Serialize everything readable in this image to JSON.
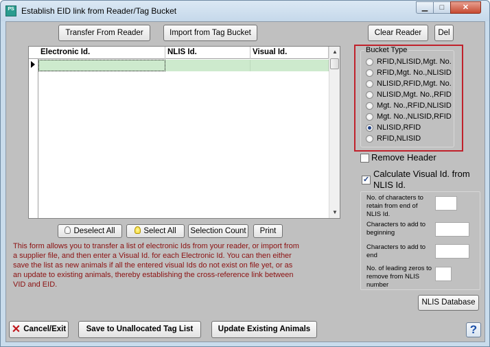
{
  "window": {
    "title": "Establish EID link from Reader/Tag Bucket",
    "app_icon_text": "PS",
    "min_glyph": "▁",
    "max_glyph": "□",
    "close_glyph": "✕"
  },
  "toolbar": {
    "transfer_label": "Transfer From Reader",
    "import_label": "Import from Tag Bucket",
    "clear_label": "Clear Reader",
    "del_label": "Del"
  },
  "grid": {
    "columns": [
      "Electronic Id.",
      "NLIS Id.",
      "Visual Id."
    ],
    "rows": [
      [
        "",
        "",
        ""
      ]
    ],
    "scroll_up": "▲",
    "scroll_down": "▼"
  },
  "bucket_type": {
    "legend": "Bucket Type",
    "options": [
      "RFID,NLISID,Mgt. No.",
      "RFID,Mgt. No.,NLISID",
      "NLISID,RFID,Mgt. No.",
      "NLISID,Mgt. No.,RFID",
      "Mgt. No.,RFID,NLISID",
      "Mgt. No.,NLISID,RFID",
      "NLISID,RFID",
      "RFID,NLISID"
    ],
    "selected_index": 6
  },
  "options": {
    "remove_header_label": "Remove Header",
    "remove_header_checked": false,
    "calc_visual_label_1": "Calculate Visual Id. from",
    "calc_visual_label_2": "NLIS Id.",
    "calc_visual_checked": true
  },
  "calc": {
    "retain_label": "No. of characters to retain from end of NLIS Id.",
    "retain_value": "",
    "add_begin_label": "Characters to add to beginning",
    "add_begin_value": "",
    "add_end_label": "Characters to add to end",
    "add_end_value": "",
    "zeros_label": "No. of leading zeros to remove from NLIS number",
    "zeros_value": ""
  },
  "selection": {
    "deselect_all_label": "Deselect All",
    "select_all_label": "Select All",
    "selection_count_label": "Selection Count",
    "print_label": "Print"
  },
  "info": {
    "text": "This form allows you to transfer a list of electronic Ids from your reader, or import from a supplier file, and then enter a Visual Id. for each Electronic Id. You can then either save the list as new animals if all the entered visual Ids do not exist on file yet, or as an update to existing animals, thereby establishing the cross-reference link between VID and EID."
  },
  "nlis_database_label": "NLIS Database",
  "footer": {
    "cancel_label": "Cancel/Exit",
    "save_label": "Save to Unallocated Tag List",
    "update_label": "Update Existing Animals",
    "help_glyph": "?"
  },
  "colors": {
    "info_text": "#8b1010",
    "grid_row": "#cdeacd",
    "highlight_box": "#c0202a",
    "window_frame": "#c9dcec",
    "form_bg": "#c0c0c0"
  },
  "icons": [
    "app-icon",
    "minimize-icon",
    "maximize-icon",
    "close-icon",
    "bulb-icon",
    "lit-bulb-icon",
    "cancel-x-icon",
    "help-icon"
  ]
}
